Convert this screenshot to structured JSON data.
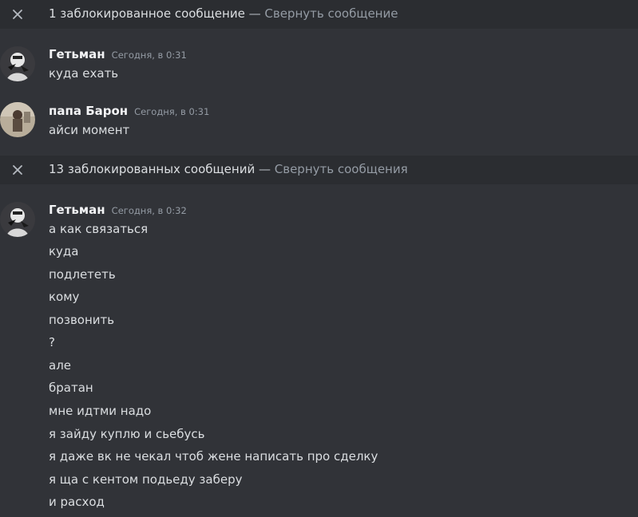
{
  "blocked1": {
    "text": "1 заблокированное сообщение",
    "separator": " — ",
    "link": "Свернуть сообщение"
  },
  "msg1": {
    "username": "Гетьман",
    "timestamp": "Сегодня, в 0:31",
    "lines": [
      "куда ехать"
    ]
  },
  "msg2": {
    "username": "папа Барон",
    "timestamp": "Сегодня, в 0:31",
    "lines": [
      "айси момент"
    ]
  },
  "blocked2": {
    "text": "13 заблокированных сообщений",
    "separator": " — ",
    "link": "Свернуть сообщения"
  },
  "msg3": {
    "username": "Гетьман",
    "timestamp": "Сегодня, в 0:32",
    "lines": [
      "а как связаться",
      "куда",
      "подлететь",
      "кому",
      "позвонить",
      "?",
      "але",
      "братан",
      "мне идтми надо",
      "я зайду куплю и сьебусь",
      "я даже вк не чекал чтоб жене написать про сделку",
      "я ща с кентом подьеду заберу",
      "и расход"
    ]
  },
  "colors": {
    "background": "#313338",
    "blocked_bar": "#2b2d31",
    "text": "#dbdee1",
    "muted": "#949ba4"
  }
}
